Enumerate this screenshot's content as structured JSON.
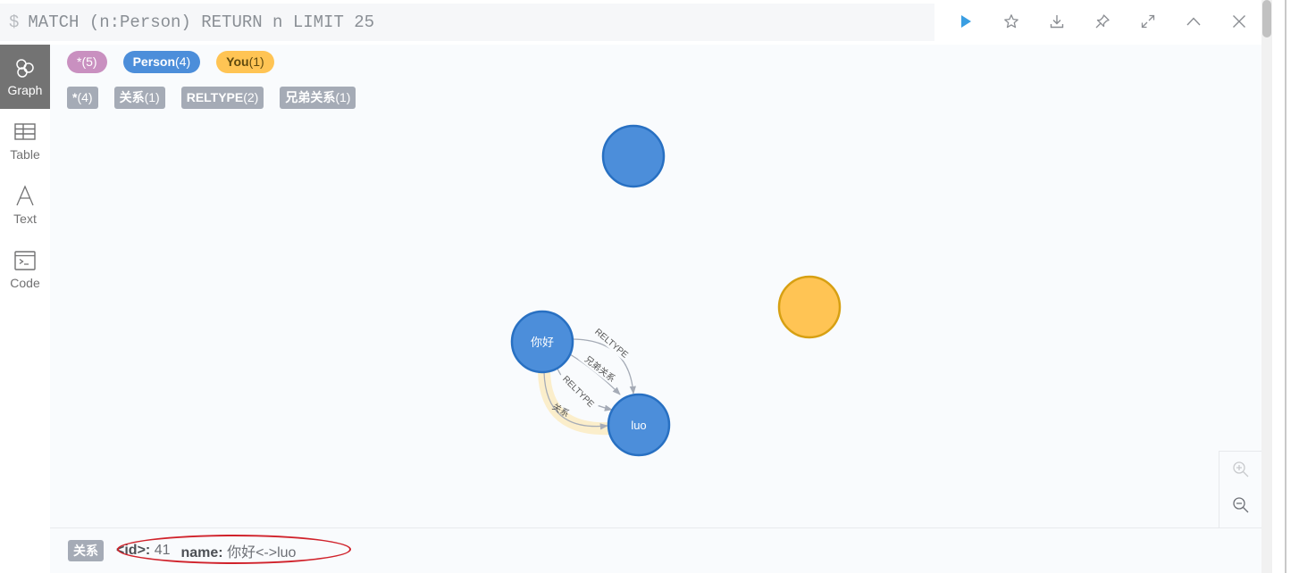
{
  "editor": {
    "prompt": "$",
    "query": "MATCH (n:Person) RETURN n LIMIT 25"
  },
  "toolbar": {
    "icons": [
      "play-icon",
      "star-icon",
      "download-icon",
      "pin-icon",
      "expand-icon",
      "collapse-icon",
      "close-icon"
    ],
    "accent": "#3a9ee2"
  },
  "tabs": [
    {
      "label": "Graph",
      "icon": "graph-icon",
      "active": true
    },
    {
      "label": "Table",
      "icon": "table-icon",
      "active": false
    },
    {
      "label": "Text",
      "icon": "text-icon",
      "active": false
    },
    {
      "label": "Code",
      "icon": "code-icon",
      "active": false
    }
  ],
  "legend": {
    "labels": [
      {
        "name": "*",
        "count": "(5)",
        "color": "#c990c0",
        "text_color": "#ffffff"
      },
      {
        "name": "Person",
        "count": "(4)",
        "color": "#4c8eda",
        "text_color": "#ffffff"
      },
      {
        "name": "You",
        "count": "(1)",
        "color": "#ffc454",
        "text_color": "#604a0e"
      }
    ],
    "relationships": [
      {
        "name": "*",
        "count": "(4)"
      },
      {
        "name": "关系",
        "count": "(1)"
      },
      {
        "name": "RELTYPE",
        "count": "(2)"
      },
      {
        "name": "兄弟关系",
        "count": "(1)"
      }
    ]
  },
  "graph": {
    "nodes": [
      {
        "id": "top",
        "label": "",
        "color": "#4c8eda",
        "stroke": "#2870c2"
      },
      {
        "id": "you",
        "label": "",
        "color": "#ffc454",
        "stroke": "#d7a013"
      },
      {
        "id": "nihao",
        "label": "你好",
        "color": "#4c8eda",
        "stroke": "#2870c2"
      },
      {
        "id": "luo",
        "label": "luo",
        "color": "#4c8eda",
        "stroke": "#2870c2"
      }
    ],
    "relationships": [
      {
        "from": "nihao",
        "to": "luo",
        "type": "RELTYPE"
      },
      {
        "from": "nihao",
        "to": "luo",
        "type": "兄弟关系"
      },
      {
        "from": "nihao",
        "to": "luo",
        "type": "RELTYPE"
      },
      {
        "from": "nihao",
        "to": "luo",
        "type": "关系",
        "selected": true
      }
    ],
    "selection_color": "#fbeecb"
  },
  "zoom": {
    "icons": [
      "zoom-in-icon",
      "zoom-out-icon"
    ]
  },
  "status": {
    "tag": "关系",
    "id_key": "<id>:",
    "id_value": "41",
    "name_key": "name:",
    "name_value": "你好<->luo"
  }
}
